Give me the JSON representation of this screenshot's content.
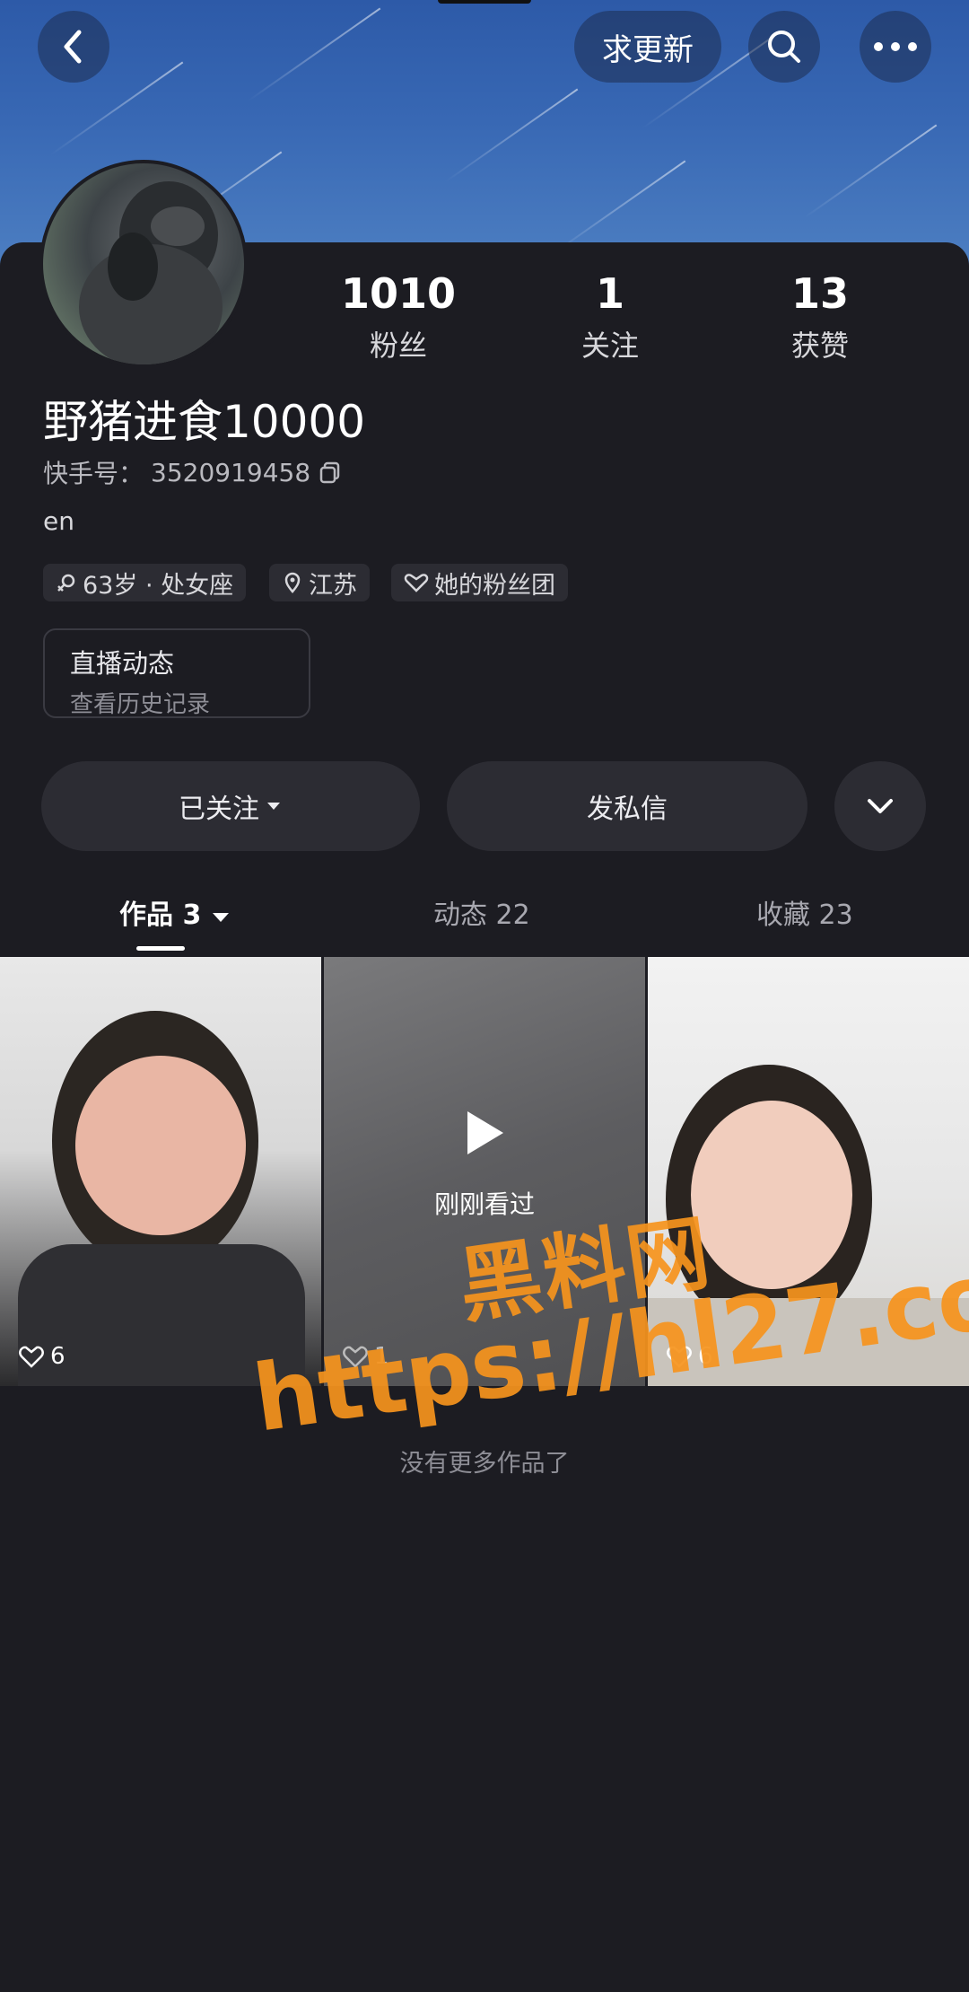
{
  "header": {
    "update_label": "求更新"
  },
  "profile": {
    "name": "野猪进食10000",
    "id_label": "快手号：",
    "id_value": "3520919458",
    "bio": "en"
  },
  "stats": [
    {
      "value": "1010",
      "label": "粉丝"
    },
    {
      "value": "1",
      "label": "关注"
    },
    {
      "value": "13",
      "label": "获赞"
    }
  ],
  "tags": [
    {
      "text": "63岁 · 处女座",
      "icon": "gender-icon"
    },
    {
      "text": "江苏",
      "icon": "location-icon"
    },
    {
      "text": "她的粉丝团",
      "icon": "fan-club-icon"
    }
  ],
  "live": {
    "title": "直播动态",
    "subtitle": "查看历史记录"
  },
  "actions": {
    "follow_label": "已关注",
    "message_label": "发私信"
  },
  "tabs": [
    {
      "label": "作品",
      "count": "3",
      "active": true
    },
    {
      "label": "动态",
      "count": "22",
      "active": false
    },
    {
      "label": "收藏",
      "count": "23",
      "active": false
    }
  ],
  "works": [
    {
      "likes": "6"
    },
    {
      "likes": "1",
      "overlay": "刚刚看过"
    },
    {
      "likes": "6"
    }
  ],
  "footer_text": "没有更多作品了",
  "watermark": {
    "line1": "黑料网",
    "line2": "https://hl27.co"
  },
  "colors": {
    "background": "#1c1c22",
    "accent_watermark": "#f7941d",
    "pill": "#2c2c33"
  }
}
